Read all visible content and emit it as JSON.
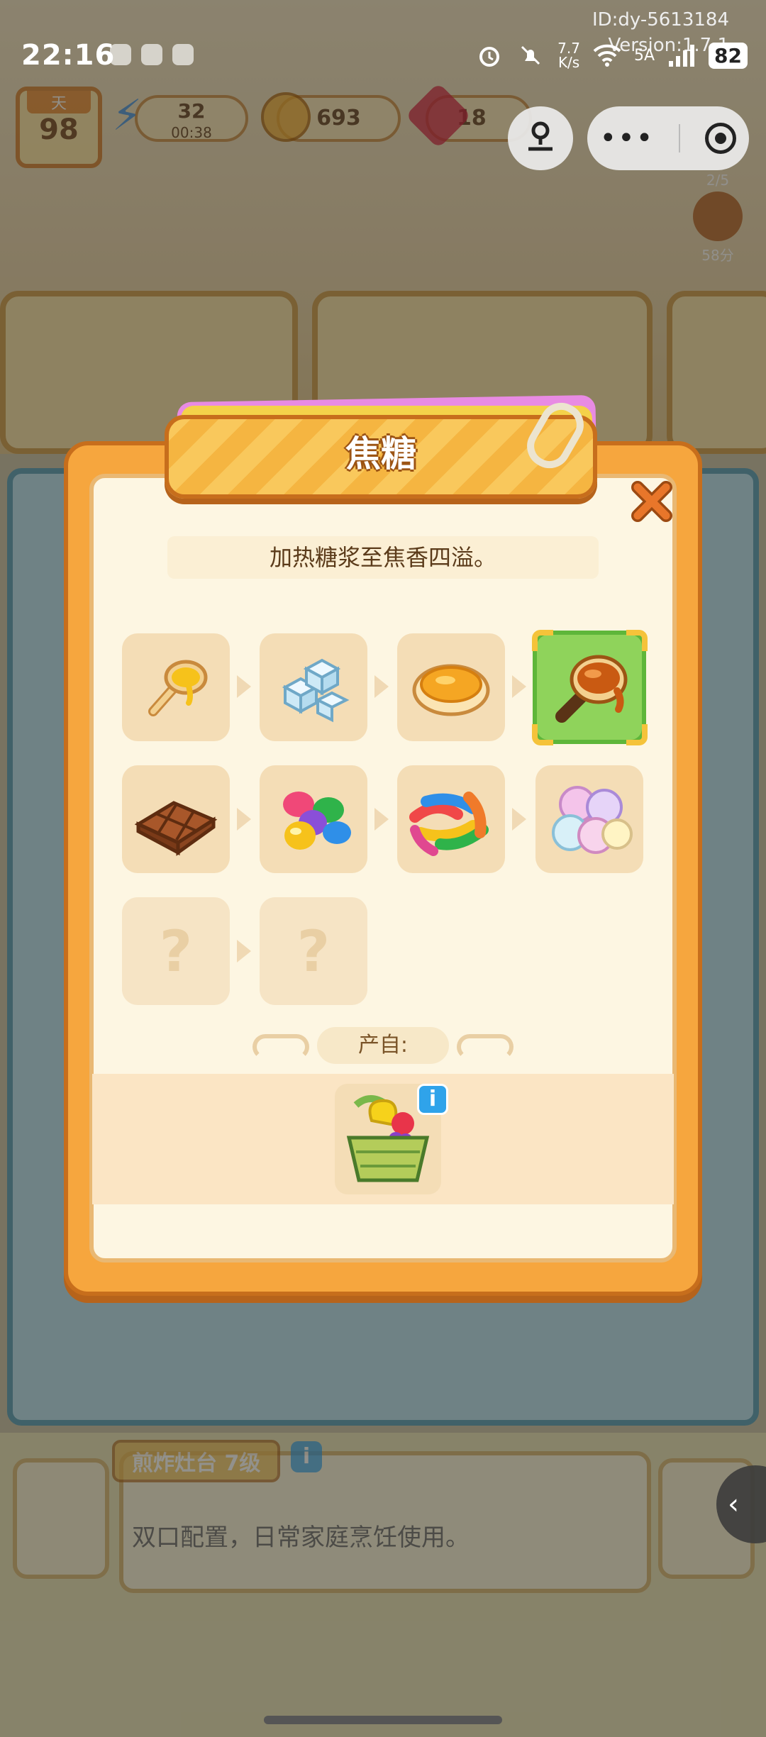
{
  "status_bar": {
    "time": "22:16",
    "watermark_id": "ID:dy-5613184",
    "watermark_version": "Version:1.7.1",
    "net_speed_value": "7.7",
    "net_speed_unit": "K/s",
    "network": "5A",
    "battery": "82"
  },
  "hud": {
    "day_label": "天",
    "day_value": "98",
    "energy_value": "32",
    "energy_timer": "00:38",
    "coins": "693",
    "gems": "18"
  },
  "order_mini": {
    "count": "2/5",
    "points": "58分"
  },
  "modal": {
    "title": "焦糖",
    "description": "加热糖浆至焦香四溢。",
    "source_label": "产自:",
    "chain_rows": [
      [
        {
          "icon": "syrup-spoon",
          "locked": false,
          "selected": false
        },
        {
          "icon": "sugar-cubes",
          "locked": false,
          "selected": false
        },
        {
          "icon": "custard-cup",
          "locked": false,
          "selected": false
        },
        {
          "icon": "caramel-spoon",
          "locked": false,
          "selected": true
        }
      ],
      [
        {
          "icon": "chocolate-bar",
          "locked": false,
          "selected": false
        },
        {
          "icon": "jelly-beans",
          "locked": false,
          "selected": false
        },
        {
          "icon": "gummy-worms",
          "locked": false,
          "selected": false
        },
        {
          "icon": "marshmallows",
          "locked": false,
          "selected": false
        }
      ],
      [
        {
          "icon": "unknown",
          "locked": true,
          "label": "?"
        },
        {
          "icon": "unknown",
          "locked": true,
          "label": "?"
        }
      ]
    ],
    "source_icon": "fruit-basket",
    "source_info": "i"
  },
  "bottom": {
    "item_title": "煎炸灶台 7级",
    "item_info": "i",
    "item_description": "双口配置，日常家庭烹饪使用。",
    "side_tab_arrow": "‹"
  },
  "colors": {
    "modal_frame": "#f6a63e",
    "modal_panel": "#fdf6e2",
    "tile": "#f4ddb6",
    "selected_tile": "#8fd35b",
    "title_text": "#ffffff",
    "close_x": "#e8762a"
  }
}
